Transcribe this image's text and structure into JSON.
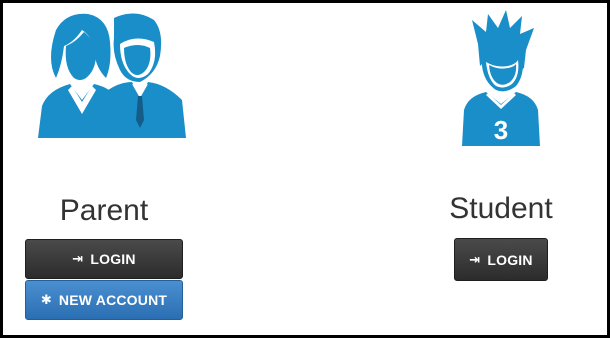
{
  "roles": {
    "parent": {
      "title": "Parent",
      "login_label": "LOGIN",
      "new_account_label": "NEW ACCOUNT",
      "login_icon": "sign-in-icon",
      "new_account_icon": "asterisk-icon"
    },
    "student": {
      "title": "Student",
      "login_label": "LOGIN",
      "login_icon": "sign-in-icon",
      "jersey_number": "3"
    }
  },
  "colors": {
    "icon_blue": "#1a8ec9",
    "button_dark": "#2c2c2c",
    "button_blue": "#2b6fb3",
    "title_text": "#333333"
  }
}
